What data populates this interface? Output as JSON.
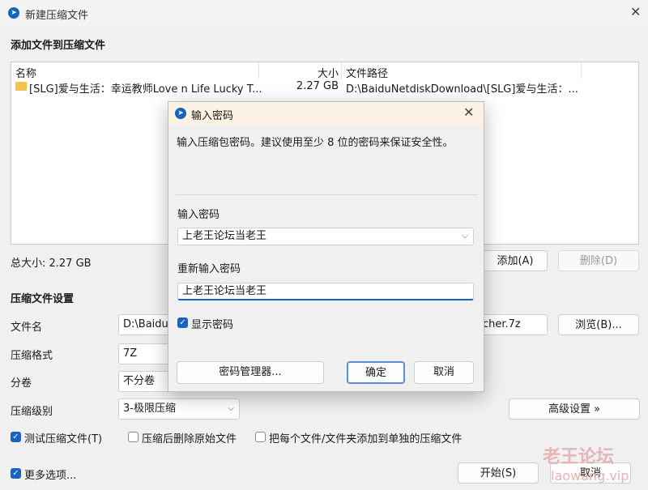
{
  "window": {
    "title": "新建压缩文件"
  },
  "add_section": {
    "title": "添加文件到压缩文件"
  },
  "file_list": {
    "columns": [
      "名称",
      "大小",
      "文件路径"
    ],
    "rows": [
      {
        "name": "[SLG]爱与生活：幸运教师Love n Life Lucky T...",
        "size": "2.27 GB",
        "path": "D:\\BaiduNetdiskDownload\\[SLG]爱与生活：..."
      }
    ]
  },
  "total_size": "总大小: 2.27 GB",
  "buttons": {
    "add": "添加(A)",
    "delete": "删除(D)",
    "browse": "浏览(B)...",
    "advanced": "高级设置 »",
    "start": "开始(S)",
    "cancel": "取消"
  },
  "settings": {
    "title": "压缩文件设置",
    "filename_label": "文件名",
    "filename_value_start": "D:\\Baidu",
    "filename_value_end": "acher.7z",
    "format_label": "压缩格式",
    "format_value": "7Z",
    "split_label": "分卷",
    "split_value": "不分卷",
    "level_label": "压缩级别",
    "level_value": "3-极限压缩"
  },
  "options": {
    "test": "测试压缩文件(T)",
    "delete_original": "压缩后删除原始文件",
    "each_separately": "把每个文件/文件夹添加到单独的压缩文件",
    "more": "更多选项..."
  },
  "password_dialog": {
    "title": "输入密码",
    "description": "输入压缩包密码。建议使用至少 8 位的密码来保证安全性。",
    "password_label": "输入密码",
    "password_value": "上老王论坛当老王",
    "confirm_label": "重新输入密码",
    "confirm_value": "上老王论坛当老王",
    "show_password": "显示密码",
    "manager_button": "密码管理器...",
    "ok_button": "确定",
    "cancel_button": "取消"
  },
  "watermark": {
    "text": "老王论坛",
    "url": "laowang.vip"
  }
}
